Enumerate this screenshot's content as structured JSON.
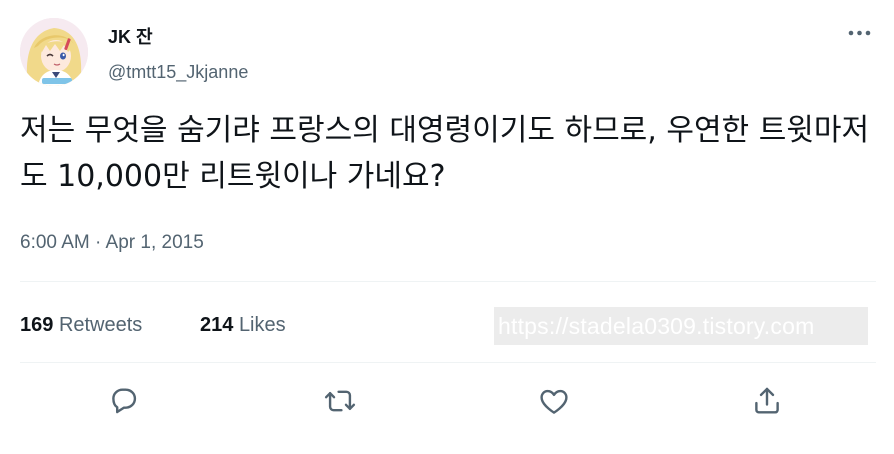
{
  "author": {
    "display_name": "JK 잔",
    "handle": "@tmtt15_Jkjanne",
    "avatar": "anime-girl-avatar"
  },
  "tweet": {
    "text": "저는 무엇을 숨기랴 프랑스의 대영령이기도 하므로, 우연한 트윗마저도 10,000만 리트윗이나 가네요?",
    "timestamp": "6:00 AM · Apr 1, 2015"
  },
  "stats": {
    "retweets_count": "169",
    "retweets_label": "Retweets",
    "likes_count": "214",
    "likes_label": "Likes"
  },
  "watermark": {
    "text": "https://stadela0309.tistory.com"
  },
  "actions": [
    {
      "name": "reply-icon"
    },
    {
      "name": "retweet-icon"
    },
    {
      "name": "like-icon"
    },
    {
      "name": "share-icon"
    }
  ],
  "colors": {
    "text_primary": "#0f1419",
    "text_secondary": "#536471",
    "divider": "#eff3f4"
  }
}
